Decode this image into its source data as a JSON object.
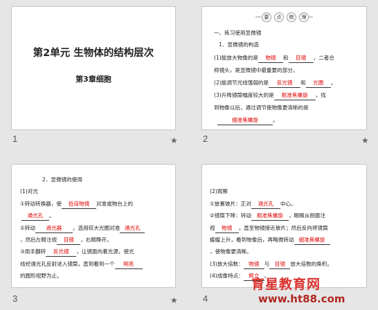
{
  "slides": [
    {
      "number": "1",
      "title": "第2单元  生物体的结构层次",
      "subtitle": "第3章细胞"
    },
    {
      "number": "2",
      "badge": [
        "要",
        "点",
        "梳",
        "理"
      ],
      "lines": {
        "h1": "一、练习使用显微镜",
        "h2": "1．显微镜的构造",
        "l1a": "(1)能放大物像的是",
        "l1ans1": "物镜",
        "l1b": "和",
        "l1ans2": "目镜",
        "l1c": "，二者合",
        "l2": "称镜头，是显微镜中最重要的部分。",
        "l3a": "(2)能调节光线强弱的是",
        "l3ans1": "反光镜",
        "l3b": "和",
        "l3ans2": "光圈",
        "l3c": "。",
        "l4a": "(3)升降镜筒幅度较大的是",
        "l4ans": "粗准焦螺旋",
        "l4b": "，找",
        "l5": "到物像以后，通过调节使物像更清晰的是",
        "l6ans": "细准焦螺旋",
        "l6b": "。"
      }
    },
    {
      "number": "3",
      "lines": {
        "h1": "2．显微镜的使用",
        "h2": "(1)对光",
        "l1a": "①转动转换器，使",
        "l1ans": "低倍物镜",
        "l1b": "对准或物台上的",
        "l2ans": "通光孔",
        "l2b": "。",
        "l3a": "②转动",
        "l3ans1": "遮光器",
        "l3b": "，选用较大光圈对准",
        "l3ans2": "通光孔",
        "l4a": "，然后左眼注视",
        "l4ans": "目镜",
        "l4b": "，右眼睁开。",
        "l5a": "③用手翻转",
        "l5ans": "反光镜",
        "l5b": "，让镜面向着光源，使光",
        "l6a": "线经通光孔反射进入镜筒，直到看到一个",
        "l6ans": "明亮",
        "l7": "的圆形视野为止。"
      }
    },
    {
      "number": "4",
      "lines": {
        "h1": "(2)观察",
        "l1a": "①放置玻片：正对",
        "l1ans": "通光孔",
        "l1b": "中心。",
        "l2a": "②镜筒下降：转动",
        "l2ans": "粗准焦螺旋",
        "l2b": "，眼睛从侧面注",
        "l3a": "视",
        "l3ans": "物镜",
        "l3b": "，直至物镜接近玻片；然后反向将镜筒",
        "l4a": "缓缓上升，看到物像后，再略微转动",
        "l4ans": "细准焦螺旋",
        "l5": "，使物像更清晰。",
        "l6a": "(3)放大倍数：",
        "l6ans1": "物镜",
        "l6b": "与",
        "l6ans2": "目镜",
        "l6c": "放大倍数的乘积。",
        "l7a": "(4)成像特点：",
        "l7ans": "倒立",
        "l7b": "。"
      }
    }
  ],
  "star_glyph": "★",
  "watermark": {
    "title": "育星教育网",
    "url": "www.ht88.com"
  },
  "colors": {
    "answer": "#e00000",
    "watermark": "#d9302c"
  }
}
